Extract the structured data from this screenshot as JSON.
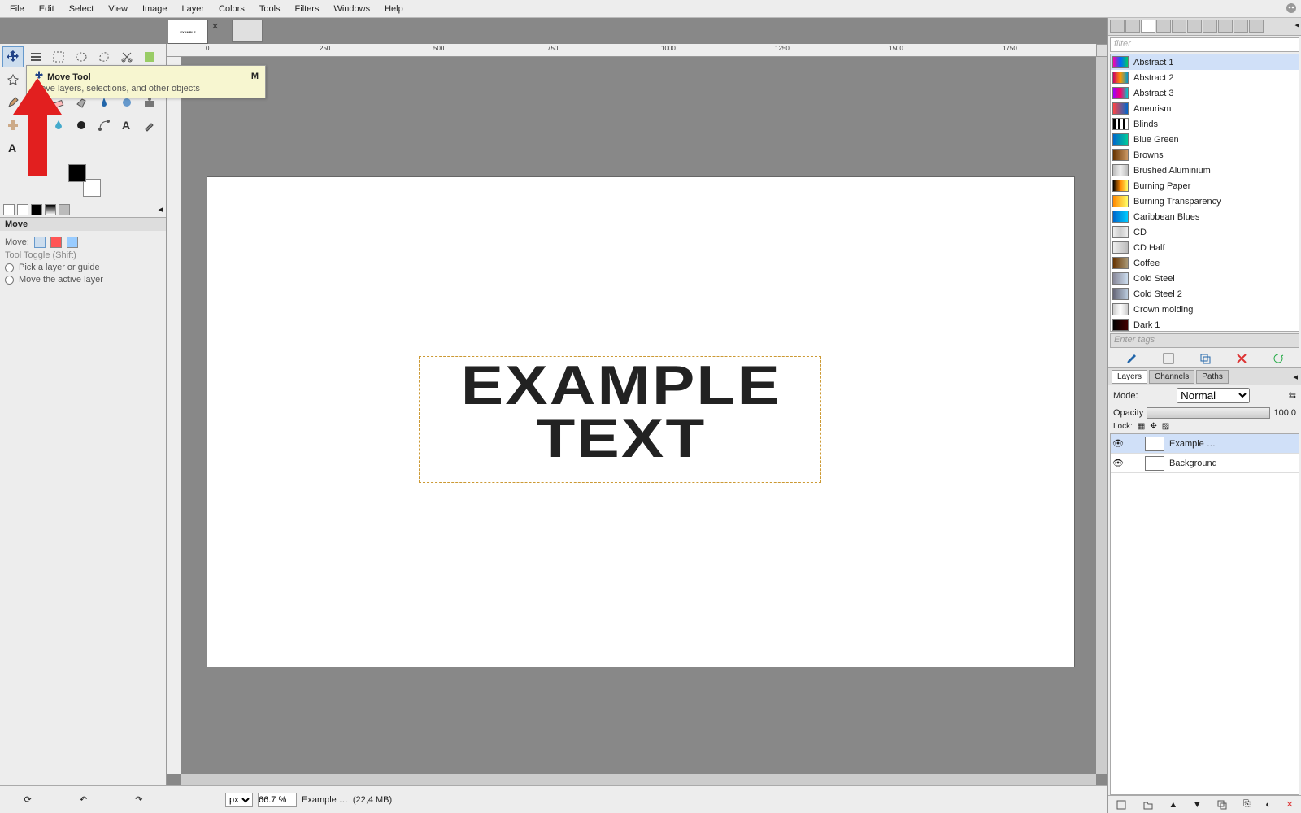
{
  "menu": [
    "File",
    "Edit",
    "Select",
    "View",
    "Image",
    "Layer",
    "Colors",
    "Tools",
    "Filters",
    "Windows",
    "Help"
  ],
  "tooltip": {
    "title": "Move Tool",
    "key": "M",
    "desc": "Move layers, selections, and other objects"
  },
  "toolopts": {
    "title": "Move",
    "moveLabel": "Move:",
    "toggle": "Tool Toggle  (Shift)",
    "r1": "Pick a layer or guide",
    "r2": "Move the active layer"
  },
  "ruler": [
    "0",
    "250",
    "500",
    "750",
    "1000",
    "1250",
    "1500",
    "1750"
  ],
  "canvasText1": "EXAMPLE",
  "canvasText2": "TEXT",
  "status": {
    "unit": "px",
    "zoom": "66.7 %",
    "doc": "Example …",
    "mem": "(22,4 MB)"
  },
  "gradients": [
    {
      "n": "Abstract 1",
      "c": "linear-gradient(90deg,#f0a,#06f,#0c6)"
    },
    {
      "n": "Abstract 2",
      "c": "linear-gradient(90deg,#c06,#f90,#09c)"
    },
    {
      "n": "Abstract 3",
      "c": "linear-gradient(90deg,#90f,#f06,#0cc)"
    },
    {
      "n": "Aneurism",
      "c": "linear-gradient(90deg,#f44,#06c)"
    },
    {
      "n": "Blinds",
      "c": "repeating-linear-gradient(90deg,#000 0 3px,#fff 3px 6px)"
    },
    {
      "n": "Blue Green",
      "c": "linear-gradient(90deg,#06c,#0c9)"
    },
    {
      "n": "Browns",
      "c": "linear-gradient(90deg,#630,#c96)"
    },
    {
      "n": "Brushed Aluminium",
      "c": "linear-gradient(90deg,#bbb,#eee,#bbb)"
    },
    {
      "n": "Burning Paper",
      "c": "linear-gradient(90deg,#000,#f80,#ff6)"
    },
    {
      "n": "Burning Transparency",
      "c": "linear-gradient(90deg,#f80,#ff6)"
    },
    {
      "n": "Caribbean Blues",
      "c": "linear-gradient(90deg,#06c,#0cf)"
    },
    {
      "n": "CD",
      "c": "linear-gradient(90deg,#eee,#ccc,#eee)"
    },
    {
      "n": "CD Half",
      "c": "linear-gradient(90deg,#eee,#bbb)"
    },
    {
      "n": "Coffee",
      "c": "linear-gradient(90deg,#630,#a97)"
    },
    {
      "n": "Cold Steel",
      "c": "linear-gradient(90deg,#889,#cde)"
    },
    {
      "n": "Cold Steel 2",
      "c": "linear-gradient(90deg,#667,#bcd)"
    },
    {
      "n": "Crown molding",
      "c": "linear-gradient(90deg,#ccc,#fff,#ccc)"
    },
    {
      "n": "Dark 1",
      "c": "linear-gradient(90deg,#000,#400)"
    }
  ],
  "filterPlaceholder": "filter",
  "tagPlaceholder": "Enter tags",
  "layerTabs": [
    "Layers",
    "Channels",
    "Paths"
  ],
  "mode": {
    "label": "Mode:",
    "value": "Normal"
  },
  "opacity": {
    "label": "Opacity",
    "value": "100.0"
  },
  "lock": "Lock:",
  "layers": [
    {
      "name": "Example …",
      "thumb": "#fff"
    },
    {
      "name": "Background",
      "thumb": "#fff"
    }
  ]
}
